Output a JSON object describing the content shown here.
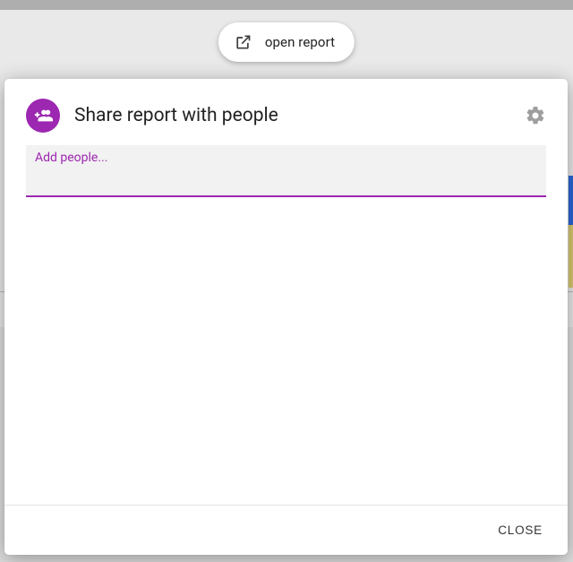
{
  "open_report": {
    "label": "open report"
  },
  "dialog": {
    "title": "Share report with people",
    "input_label": "Add people...",
    "input_value": "",
    "close_label": "CLOSE"
  }
}
